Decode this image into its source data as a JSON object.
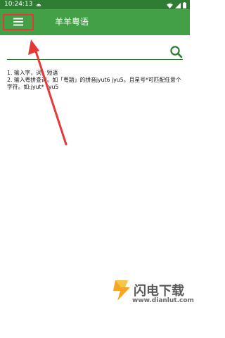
{
  "status_bar": {
    "time": "10:24:13",
    "icons": [
      "android-icon",
      "wifi-icon",
      "signal-icon",
      "battery-icon"
    ]
  },
  "toolbar": {
    "title": "羊羊粤语",
    "menu_icon": "hamburger-menu-icon",
    "background": "#43a047",
    "highlight_color": "#e53935"
  },
  "search": {
    "value": "",
    "placeholder": "",
    "icon": "search-icon",
    "accent": "#2e7d32"
  },
  "instructions": {
    "line1": "1. 输入字，词，短语",
    "line2": "2. 输入粤拼查询。如「粤語」的拼音jyut6  jyu5。且星号*可匹配任意个字符。如:jyut*  *yu5"
  },
  "annotation": {
    "arrow_color": "#e53935"
  },
  "watermark": {
    "brand": "闪电下载",
    "url": "www.dianlut.com"
  }
}
